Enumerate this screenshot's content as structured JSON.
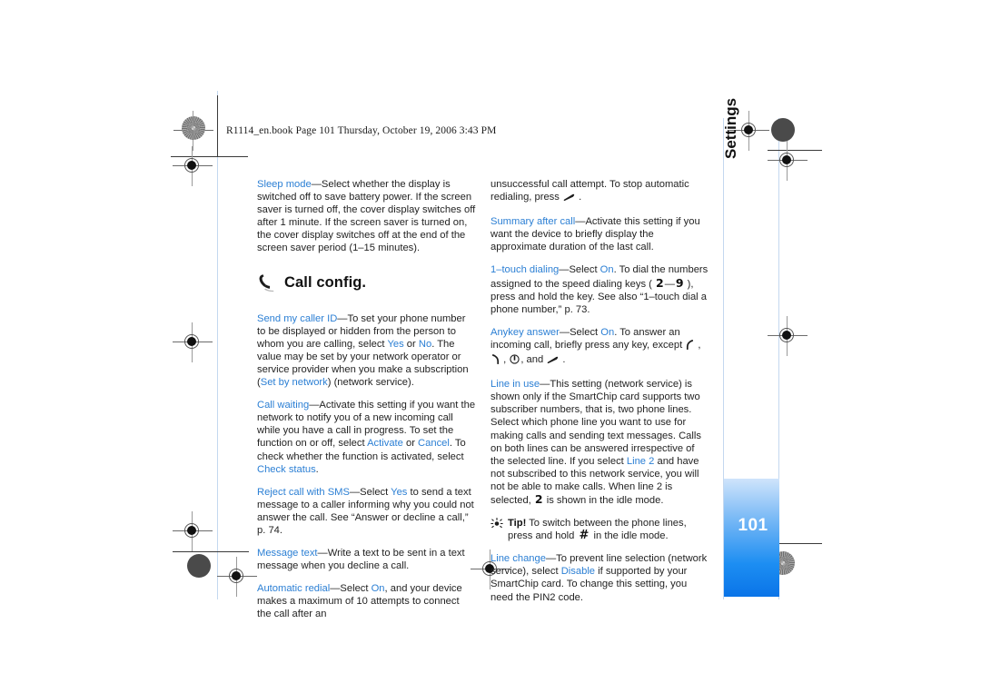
{
  "document": {
    "slug": "R1114_en.book  Page 101  Thursday, October 19, 2006  3:43 PM",
    "page_number": "101",
    "side_tab_label": "Settings",
    "accent_color": "#2b7fd4",
    "page_tab_color": "#1d8ef2"
  },
  "left_column": {
    "paragraphs": [
      {
        "id": "sleep-mode",
        "term": "Sleep mode",
        "dash": "—",
        "body_start": "Select whether the display is switched off to save battery power. If the screen saver is turned off, the cover display switches off after 1 minute. If the screen saver is turned on, the cover display switches off at the end of the screen saver period (1–15 minutes)."
      }
    ],
    "section": {
      "icon": "phone-handset-icon",
      "title": "Call config."
    },
    "after_section": [
      {
        "id": "send-my-caller-id",
        "term": "Send my caller ID",
        "dash": "—",
        "seg1": "To set your phone number to be displayed or hidden from the person to whom you are calling, select ",
        "val1": "Yes",
        "seg2": " or ",
        "val2": "No",
        "seg3": ". The value may be set by your network operator or service provider when you make a subscription (",
        "val3": "Set by network",
        "seg4": ") (network service)."
      },
      {
        "id": "call-waiting",
        "term": "Call waiting",
        "dash": "—",
        "seg1": "Activate this setting if you want the network to notify you of a new incoming call while you have a call in progress. To set the function on or off, select ",
        "val1": "Activate",
        "seg2": " or ",
        "val2": "Cancel",
        "seg3": ". To check whether the function is activated, select ",
        "val3": "Check status",
        "seg4": "."
      },
      {
        "id": "reject-call-with-sms",
        "term": "Reject call with SMS",
        "dash": "—",
        "seg1": "Select ",
        "val1": "Yes",
        "seg2": " to send a text message to a caller informing why you could not answer the call. See “Answer or decline a call,” p. 74."
      },
      {
        "id": "message-text",
        "term": "Message text",
        "dash": "—",
        "seg1": "Write a text to be sent in a text message when you decline a call."
      },
      {
        "id": "automatic-redial",
        "term": "Automatic redial",
        "dash": "—",
        "seg1": "Select ",
        "val1": "On",
        "seg2": ", and your device makes a maximum of 10 attempts to connect the call after an"
      }
    ]
  },
  "right_column": {
    "continuation": {
      "id": "automatic-redial-continued",
      "seg1": "unsuccessful call attempt. To stop automatic redialing, press ",
      "key": "end-call-key-icon",
      "seg2": " ."
    },
    "paragraphs": [
      {
        "id": "summary-after-call",
        "term": "Summary after call",
        "dash": "—",
        "seg1": "Activate this setting if you want the device to briefly display the approximate duration of the last call."
      },
      {
        "id": "one-touch-dialing",
        "term": "1–touch dialing",
        "dash": "—",
        "seg1": "Select ",
        "val1": "On",
        "seg2": ". To dial the numbers assigned to the speed dialing keys ( ",
        "key_from": "2",
        "key_dash": "—",
        "key_to": "9",
        "seg3": " ), press and hold the key. See also “1–touch dial a phone number,” p. 73."
      },
      {
        "id": "anykey-answer",
        "term": "Anykey answer",
        "dash": "—",
        "seg1": "Select ",
        "val1": "On",
        "seg2": ". To answer an incoming call, briefly press any key, except ",
        "key1": "left-soft-key-icon",
        "sep1": " , ",
        "key2": "right-soft-key-icon",
        "sep2": " , ",
        "key3": "power-key-icon",
        "sep3": ", and ",
        "key4": "end-call-key-icon",
        "seg3": " ."
      },
      {
        "id": "line-in-use",
        "term": "Line in use",
        "dash": "—",
        "seg1": "This setting (network service) is shown only if the SmartChip card supports two subscriber numbers, that is, two phone lines. Select which phone line you want to use for making calls and sending text messages. Calls on both lines can be answered irrespective of the selected line. If you select ",
        "val1": "Line 2",
        "seg2": " and have not subscribed to this network service, you will not be able to make calls. When line 2 is selected, ",
        "key_digit": "2",
        "seg3": " is shown in the idle mode."
      }
    ],
    "tip": {
      "id": "tip-switch-lines",
      "icon": "tip-lightbulb-icon",
      "label": "Tip!",
      "seg1": " To switch between the phone lines, press and hold ",
      "key": "#",
      "seg2": " in the idle mode."
    },
    "last_paragraph": {
      "id": "line-change",
      "term": "Line change",
      "dash": "—",
      "seg1": "To prevent line selection (network service), select ",
      "val1": "Disable",
      "seg2": " if supported by your SmartChip card. To change this setting, you need the PIN2 code."
    }
  }
}
